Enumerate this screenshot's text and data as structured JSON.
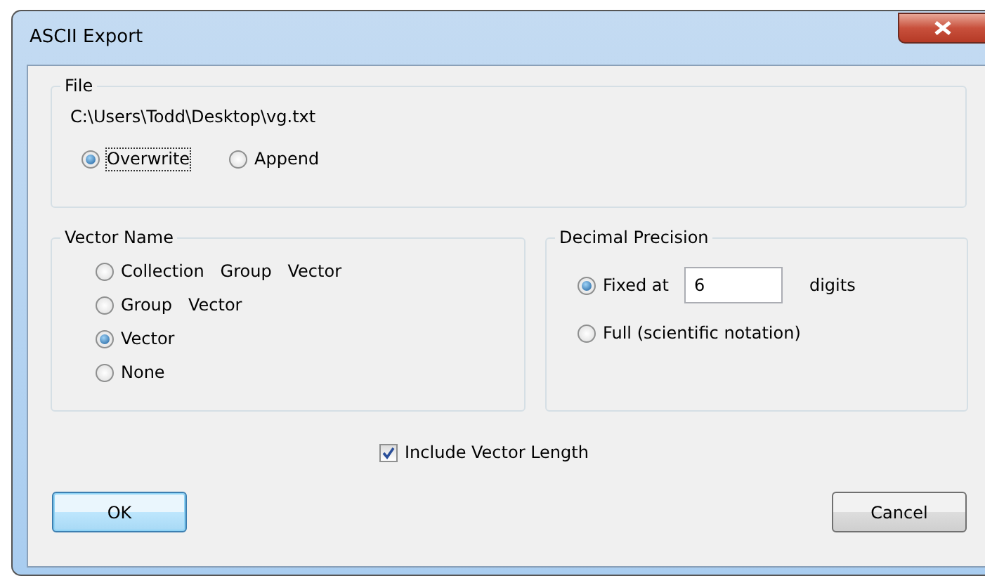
{
  "window": {
    "title": "ASCII Export"
  },
  "file_group": {
    "title": "File",
    "path": "C:\\Users\\Todd\\Desktop\\vg.txt",
    "options": [
      {
        "label": "Overwrite",
        "selected": true,
        "focused": true
      },
      {
        "label": "Append",
        "selected": false,
        "focused": false
      }
    ]
  },
  "vector_name": {
    "title": "Vector Name",
    "options": [
      {
        "label": "Collection   Group   Vector",
        "selected": false
      },
      {
        "label": "Group   Vector",
        "selected": false
      },
      {
        "label": "Vector",
        "selected": true
      },
      {
        "label": "None",
        "selected": false
      }
    ]
  },
  "decimal_precision": {
    "title": "Decimal Precision",
    "options": [
      {
        "kind": "fixed",
        "label": "Fixed at",
        "value": "6",
        "suffix": "digits",
        "selected": true
      },
      {
        "kind": "plain",
        "label": "Full (scientific notation)",
        "selected": false
      }
    ]
  },
  "include_vector_length": {
    "label": "Include Vector Length",
    "checked": true
  },
  "buttons": [
    {
      "label": "OK",
      "default": true
    },
    {
      "label": "Cancel",
      "default": false
    }
  ]
}
